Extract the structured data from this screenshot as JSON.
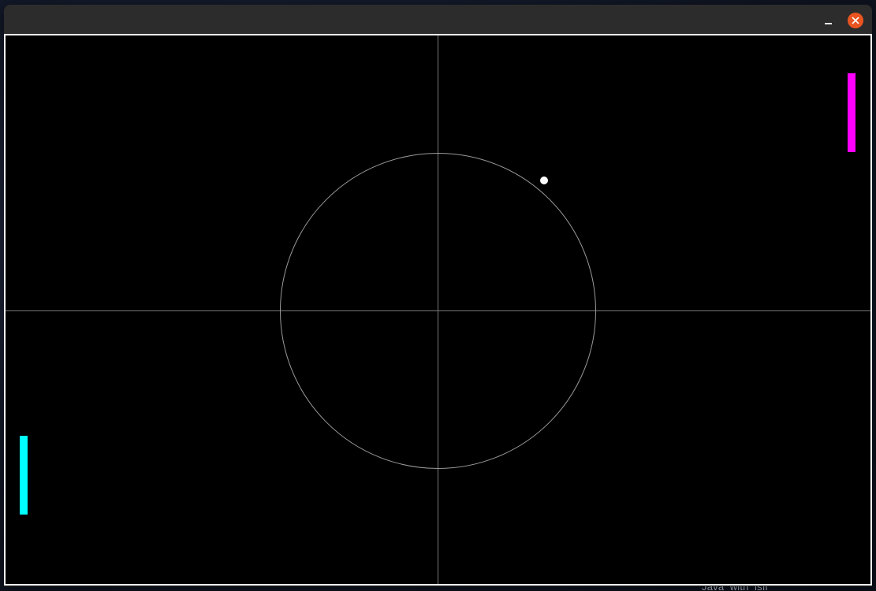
{
  "window": {
    "title": "",
    "minimize_icon": "minimize-icon",
    "close_icon": "close-icon",
    "close_color": "#e95420"
  },
  "desktop": {
    "label": "Java_with_isfl"
  },
  "game": {
    "background_color": "#000000",
    "border_color": "#ffffff",
    "line_color": "#777777",
    "left_paddle_color": "#00ffff",
    "right_paddle_color": "#ff00ff",
    "ball_color": "#ffffff"
  }
}
